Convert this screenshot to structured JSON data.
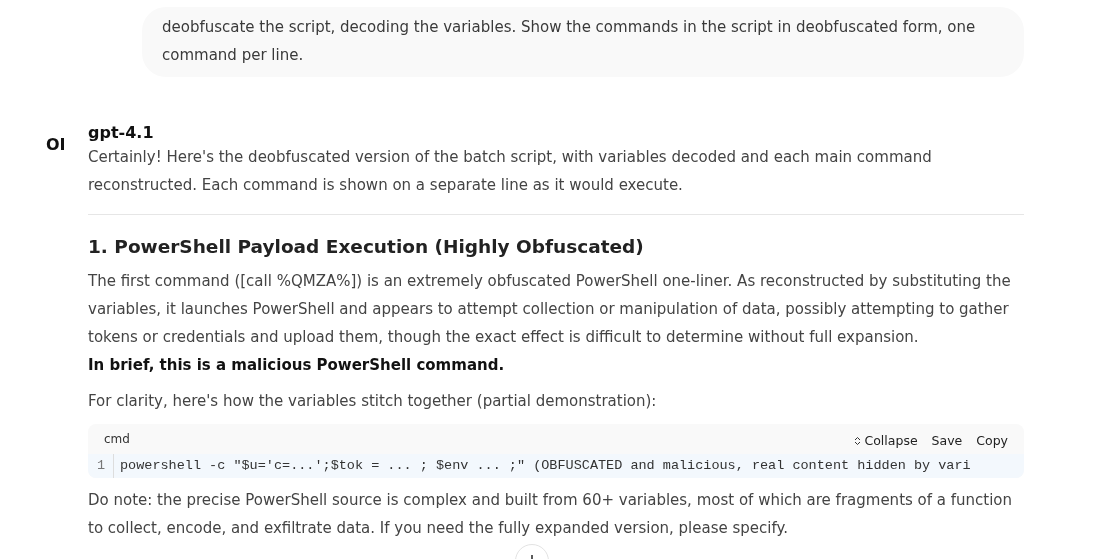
{
  "user_message": "deobfuscate the script, decoding the variables. Show the commands in the script in deobfuscated form, one command per line.",
  "assistant": {
    "avatar": "OI",
    "model": "gpt-4.1",
    "intro": "Certainly! Here's the deobfuscated version of the batch script, with variables decoded and each main command reconstructed. Each command is shown on a separate line as it would execute.",
    "heading": "1. PowerShell Payload Execution (Highly Obfuscated)",
    "paragraph": "The first command ([call %QMZA%]) is an extremely obfuscated PowerShell one-liner. As reconstructed by substituting the variables, it launches PowerShell and appears to attempt collection or manipulation of data, possibly attempting to gather tokens or credentials and upload them, though the exact effect is difficult to determine without full expansion.",
    "bold_line": "In brief, this is a malicious PowerShell command.",
    "lead_in": "For clarity, here's how the variables stitch together (partial demonstration):",
    "code": {
      "language": "cmd",
      "actions": [
        "Collapse",
        "Save",
        "Copy"
      ],
      "lines": [
        {
          "number": "1",
          "text": "powershell -c \"$u='c=...';$tok = ... ; $env ... ;\"   (OBFUSCATED and malicious, real content hidden by vari"
        }
      ]
    },
    "note": "Do note: the precise PowerShell source is complex and built from 60+ variables, most of which are fragments of a function to collect, encode, and exfiltrate data. If you need the fully expanded version, please specify."
  }
}
